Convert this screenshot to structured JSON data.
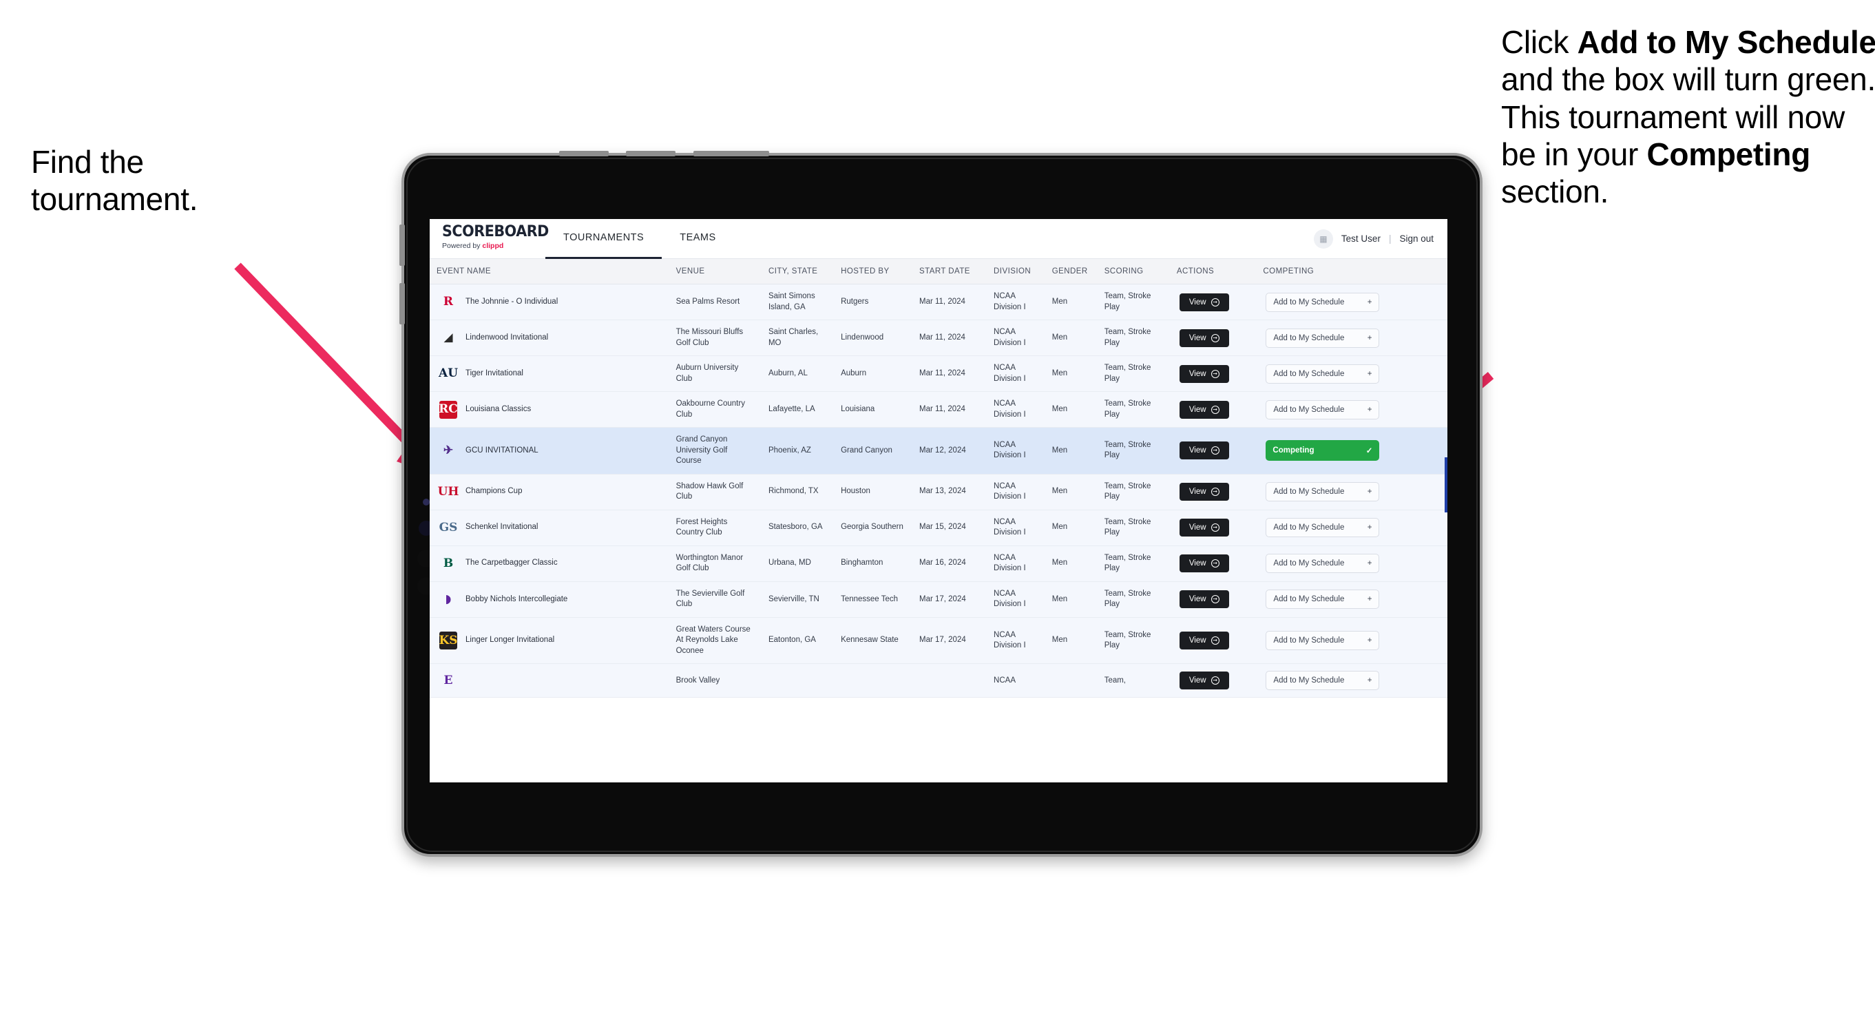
{
  "annotations": {
    "left": {
      "line1": "Find the",
      "line2": "tournament."
    },
    "right": {
      "seg1": "Click ",
      "bold1": "Add to My Schedule",
      "seg2": " and the box will turn green. This tournament will now be in your ",
      "bold2": "Competing",
      "seg3": " section."
    },
    "arrow_color": "#ec2a5e"
  },
  "app": {
    "brand": {
      "name": "SCOREBOARD",
      "tagline_prefix": "Powered by ",
      "tagline_brand": "clippd"
    },
    "tabs": [
      {
        "label": "TOURNAMENTS",
        "active": true
      },
      {
        "label": "TEAMS",
        "active": false
      }
    ],
    "user": {
      "avatar_icon": "user-avatar-icon",
      "name": "Test User",
      "separator": "|",
      "signout": "Sign out"
    }
  },
  "table": {
    "columns": [
      "EVENT NAME",
      "VENUE",
      "CITY, STATE",
      "HOSTED BY",
      "START DATE",
      "DIVISION",
      "GENDER",
      "SCORING",
      "ACTIONS",
      "COMPETING"
    ],
    "view_label": "View",
    "add_label": "Add to My Schedule",
    "add_icon": "plus-icon",
    "competing_label": "Competing",
    "competing_icon": "check-icon",
    "competing_color": "#22a745",
    "rows": [
      {
        "logo_text": "R",
        "logo_color": "#cc0033",
        "logo_bg": "transparent",
        "event": "The Johnnie - O Individual",
        "venue": "Sea Palms Resort",
        "city": "Saint Simons Island, GA",
        "host": "Rutgers",
        "date": "Mar 11, 2024",
        "division": "NCAA Division I",
        "gender": "Men",
        "scoring": "Team, Stroke Play",
        "competing": false,
        "highlight": false
      },
      {
        "logo_text": "◢",
        "logo_color": "#2b2b2b",
        "logo_bg": "transparent",
        "event": "Lindenwood Invitational",
        "venue": "The Missouri Bluffs Golf Club",
        "city": "Saint Charles, MO",
        "host": "Lindenwood",
        "date": "Mar 11, 2024",
        "division": "NCAA Division I",
        "gender": "Men",
        "scoring": "Team, Stroke Play",
        "competing": false,
        "highlight": false
      },
      {
        "logo_text": "AU",
        "logo_color": "#0c2340",
        "logo_bg": "transparent",
        "event": "Tiger Invitational",
        "venue": "Auburn University Club",
        "city": "Auburn, AL",
        "host": "Auburn",
        "date": "Mar 11, 2024",
        "division": "NCAA Division I",
        "gender": "Men",
        "scoring": "Team, Stroke Play",
        "competing": false,
        "highlight": false
      },
      {
        "logo_text": "RC",
        "logo_color": "#ffffff",
        "logo_bg": "#ce1126",
        "event": "Louisiana Classics",
        "venue": "Oakbourne Country Club",
        "city": "Lafayette, LA",
        "host": "Louisiana",
        "date": "Mar 11, 2024",
        "division": "NCAA Division I",
        "gender": "Men",
        "scoring": "Team, Stroke Play",
        "competing": false,
        "highlight": false
      },
      {
        "logo_text": "✈",
        "logo_color": "#522d8a",
        "logo_bg": "transparent",
        "event": "GCU INVITATIONAL",
        "venue": "Grand Canyon University Golf Course",
        "city": "Phoenix, AZ",
        "host": "Grand Canyon",
        "date": "Mar 12, 2024",
        "division": "NCAA Division I",
        "gender": "Men",
        "scoring": "Team, Stroke Play",
        "competing": true,
        "highlight": true
      },
      {
        "logo_text": "UH",
        "logo_color": "#c8102e",
        "logo_bg": "transparent",
        "event": "Champions Cup",
        "venue": "Shadow Hawk Golf Club",
        "city": "Richmond, TX",
        "host": "Houston",
        "date": "Mar 13, 2024",
        "division": "NCAA Division I",
        "gender": "Men",
        "scoring": "Team, Stroke Play",
        "competing": false,
        "highlight": false
      },
      {
        "logo_text": "GS",
        "logo_color": "#4a6a8a",
        "logo_bg": "transparent",
        "event": "Schenkel Invitational",
        "venue": "Forest Heights Country Club",
        "city": "Statesboro, GA",
        "host": "Georgia Southern",
        "date": "Mar 15, 2024",
        "division": "NCAA Division I",
        "gender": "Men",
        "scoring": "Team, Stroke Play",
        "competing": false,
        "highlight": false
      },
      {
        "logo_text": "B",
        "logo_color": "#005a43",
        "logo_bg": "transparent",
        "event": "The Carpetbagger Classic",
        "venue": "Worthington Manor Golf Club",
        "city": "Urbana, MD",
        "host": "Binghamton",
        "date": "Mar 16, 2024",
        "division": "NCAA Division I",
        "gender": "Men",
        "scoring": "Team, Stroke Play",
        "competing": false,
        "highlight": false
      },
      {
        "logo_text": "◗",
        "logo_color": "#5f259f",
        "logo_bg": "transparent",
        "event": "Bobby Nichols Intercollegiate",
        "venue": "The Sevierville Golf Club",
        "city": "Sevierville, TN",
        "host": "Tennessee Tech",
        "date": "Mar 17, 2024",
        "division": "NCAA Division I",
        "gender": "Men",
        "scoring": "Team, Stroke Play",
        "competing": false,
        "highlight": false
      },
      {
        "logo_text": "KS",
        "logo_color": "#ffc629",
        "logo_bg": "#231f20",
        "event": "Linger Longer Invitational",
        "venue": "Great Waters Course At Reynolds Lake Oconee",
        "city": "Eatonton, GA",
        "host": "Kennesaw State",
        "date": "Mar 17, 2024",
        "division": "NCAA Division I",
        "gender": "Men",
        "scoring": "Team, Stroke Play",
        "competing": false,
        "highlight": false
      },
      {
        "logo_text": "E",
        "logo_color": "#5f259f",
        "logo_bg": "transparent",
        "event": "",
        "venue": "Brook Valley",
        "city": "",
        "host": "",
        "date": "",
        "division": "NCAA",
        "gender": "",
        "scoring": "Team,",
        "competing": false,
        "highlight": false
      }
    ]
  }
}
